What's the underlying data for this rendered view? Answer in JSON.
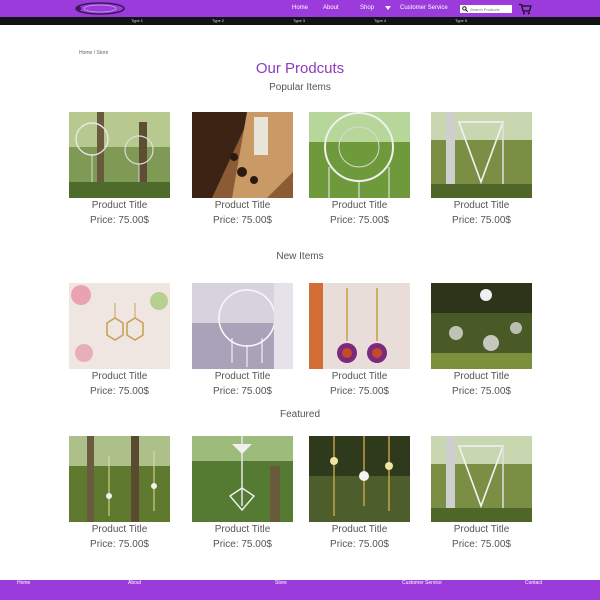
{
  "header": {
    "nav": [
      "Home",
      "About",
      "Shop",
      "Customer Service"
    ],
    "search_placeholder": "Search Products",
    "categories": [
      "Type 1",
      "Type 2",
      "Type 3",
      "Type 4",
      "Type 5"
    ],
    "accent_color": "#9b3bdc"
  },
  "breadcrumb": "Home / Store",
  "page_title": "Our Prodcuts",
  "sections": [
    {
      "heading": "Popular Items",
      "products": [
        {
          "title": "Product Title",
          "price": "Price: 75.00$"
        },
        {
          "title": "Product Title",
          "price": "Price: 75.00$"
        },
        {
          "title": "Product Title",
          "price": "Price: 75.00$"
        },
        {
          "title": "Product Title",
          "price": "Price: 75.00$"
        }
      ]
    },
    {
      "heading": "New Items",
      "products": [
        {
          "title": "Product Title",
          "price": "Price: 75.00$"
        },
        {
          "title": "Product Title",
          "price": "Price: 75.00$"
        },
        {
          "title": "Product Title",
          "price": "Price: 75.00$"
        },
        {
          "title": "Product Title",
          "price": "Price: 75.00$"
        }
      ]
    },
    {
      "heading": "Featured",
      "products": [
        {
          "title": "Product Title",
          "price": "Price: 75.00$"
        },
        {
          "title": "Product Title",
          "price": "Price: 75.00$"
        },
        {
          "title": "Product Title",
          "price": "Price: 75.00$"
        },
        {
          "title": "Product Title",
          "price": "Price: 75.00$"
        }
      ]
    }
  ],
  "footer": [
    "Home",
    "About",
    "Store",
    "Customer Service",
    "Contact"
  ]
}
